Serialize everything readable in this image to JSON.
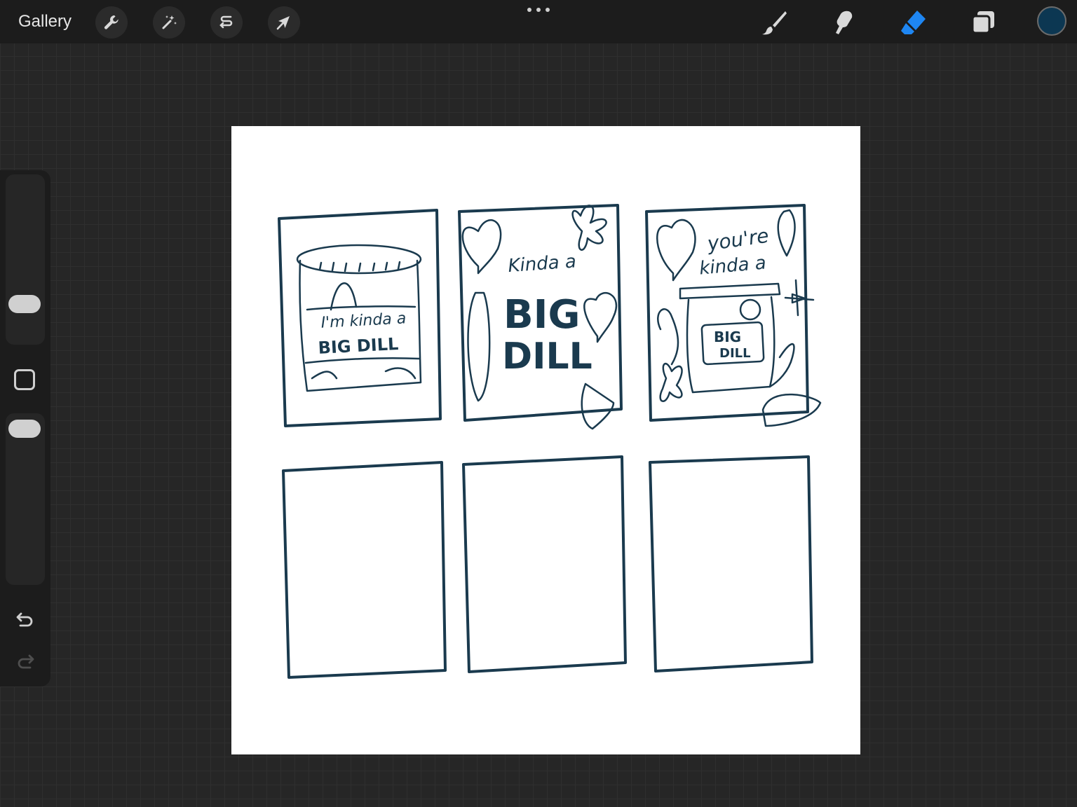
{
  "toolbar": {
    "gallery_label": "Gallery",
    "left_tools": [
      "wrench-icon",
      "magic-wand-icon",
      "selection-icon",
      "transform-arrow-icon"
    ],
    "right_tools": [
      "brush-icon",
      "smudge-icon",
      "eraser-icon",
      "layers-icon"
    ],
    "active_tool": "eraser-icon",
    "accent_color": "#1e86f2",
    "current_color": "#0c3752"
  },
  "sidebar": {
    "brush_size_level": 0.25,
    "opacity_level": 0.1,
    "undo_icon": "undo-icon",
    "redo_icon": "redo-icon"
  },
  "canvas": {
    "stroke_color": "#1a3a4e",
    "panels": [
      {
        "lines": [
          "I'm kinda a",
          "BIG DILL"
        ]
      },
      {
        "lines": [
          "Kinda a",
          "BIG",
          "DILL"
        ]
      },
      {
        "lines": [
          "you're",
          "kinda a",
          "BIG",
          "DILL"
        ]
      }
    ]
  }
}
